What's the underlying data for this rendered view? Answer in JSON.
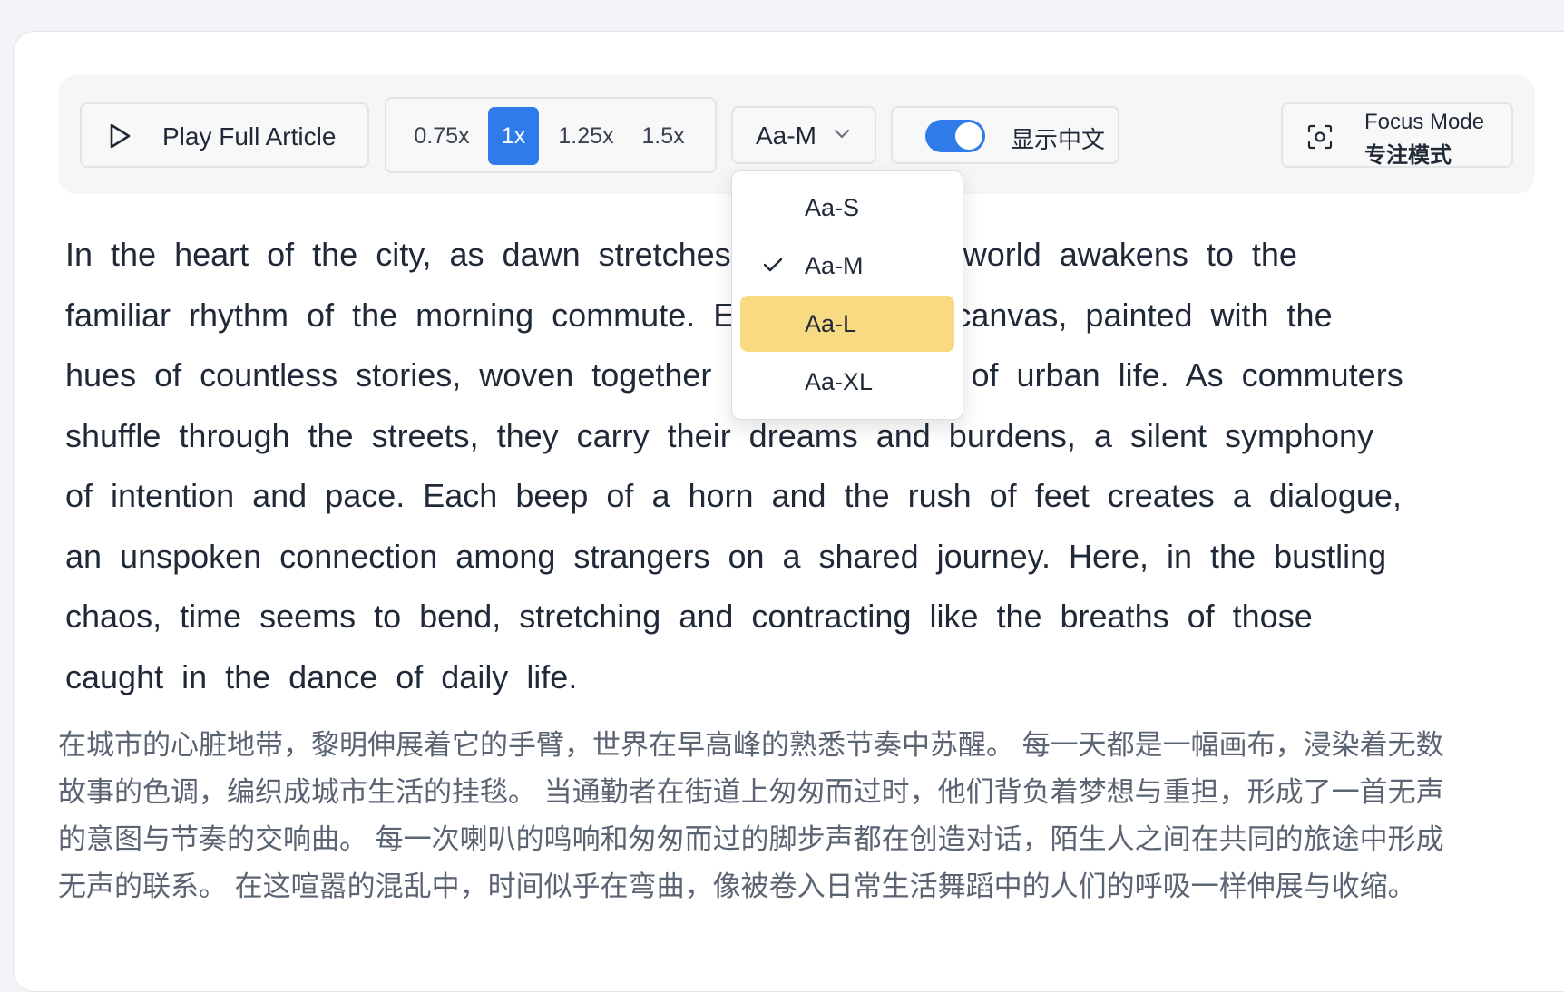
{
  "toolbar": {
    "play_label": "Play Full Article",
    "speed_options": [
      "0.75x",
      "1x",
      "1.25x",
      "1.5x"
    ],
    "speed_selected": "1x",
    "font_size_selected": "Aa-M",
    "chinese_toggle_label": "显示中文",
    "chinese_toggle_on": true,
    "focus_mode_en": "Focus Mode",
    "focus_mode_zh": "专注模式"
  },
  "font_size_dropdown": {
    "options": [
      "Aa-S",
      "Aa-M",
      "Aa-L",
      "Aa-XL"
    ],
    "checked": "Aa-M",
    "highlighted": "Aa-L"
  },
  "article": {
    "english_lines": [
      "In the heart of the city, as dawn stretches its arms, the world awakens to the",
      "familiar rhythm of the morning commute. Each day is a canvas, painted with the",
      "hues of countless stories, woven together into a tapestry of urban life. As commuters",
      "shuffle through the streets, they carry their dreams and burdens, a silent symphony",
      "of intention and pace. Each beep of a horn and the rush of feet creates a dialogue,",
      "an unspoken connection among strangers on a shared journey. Here, in the bustling",
      "chaos, time seems to bend, stretching and contracting like the breaths of those",
      "caught in the dance of daily life."
    ],
    "chinese_lines": [
      "在城市的心脏地带，黎明伸展着它的手臂，世界在早高峰的熟悉节奏中苏醒。 每一天都是一幅画布，浸染着无数",
      "故事的色调，编织成城市生活的挂毯。 当通勤者在街道上匆匆而过时，他们背负着梦想与重担，形成了一首无声",
      "的意图与节奏的交响曲。 每一次喇叭的鸣响和匆匆而过的脚步声都在创造对话，陌生人之间在共同的旅途中形成",
      "无声的联系。 在这喧嚣的混乱中，时间似乎在弯曲，像被卷入日常生活舞蹈中的人们的呼吸一样伸展与收缩。"
    ]
  },
  "colors": {
    "accent": "#2f7bea",
    "highlight": "#f8da83"
  }
}
